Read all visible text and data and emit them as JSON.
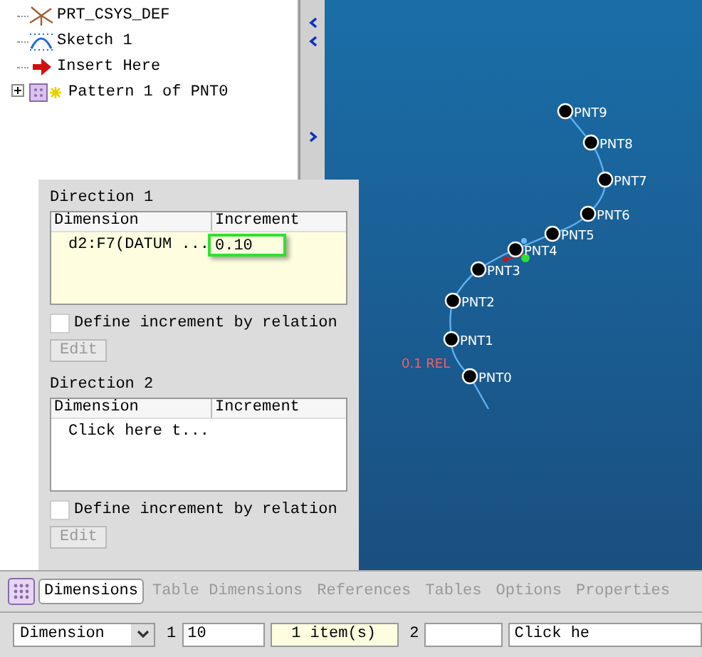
{
  "tree": {
    "items": [
      {
        "label": "PRT_CSYS_DEF",
        "kind": "csys"
      },
      {
        "label": "Sketch 1",
        "kind": "sketch"
      },
      {
        "label": "Insert Here",
        "kind": "insert"
      },
      {
        "label": "Pattern 1 of PNT0",
        "kind": "pattern",
        "expanded": false
      }
    ]
  },
  "viewport": {
    "points": [
      "PNT0",
      "PNT1",
      "PNT2",
      "PNT3",
      "PNT4",
      "PNT5",
      "PNT6",
      "PNT7",
      "PNT8",
      "PNT9"
    ],
    "annotation": "0.1 REL"
  },
  "panel": {
    "sections": [
      {
        "title": "Direction 1",
        "columns": [
          "Dimension",
          "Increment"
        ],
        "active": true,
        "rows": [
          {
            "dimension": "d2:F7(DATUM ...",
            "increment": "0.10",
            "editing": true
          }
        ],
        "relation": {
          "label": "Define increment by relation",
          "checked": false
        },
        "edit_button": {
          "label": "Edit",
          "disabled": true
        }
      },
      {
        "title": "Direction 2",
        "columns": [
          "Dimension",
          "Increment"
        ],
        "active": false,
        "rows": [
          {
            "dimension": "Click here t..."
          }
        ],
        "relation": {
          "label": "Define increment by relation",
          "checked": false
        },
        "edit_button": {
          "label": "Edit",
          "disabled": true
        }
      }
    ]
  },
  "tabs": [
    {
      "label": "Dimensions",
      "selected": true
    },
    {
      "label": "Table Dimensions",
      "selected": false
    },
    {
      "label": "References",
      "selected": false
    },
    {
      "label": "Tables",
      "selected": false
    },
    {
      "label": "Options",
      "selected": false
    },
    {
      "label": "Properties",
      "selected": false
    }
  ],
  "bottom_bar": {
    "type_select": "Dimension",
    "count_1": "1",
    "value_1": "10",
    "items_1": "1 item(s)",
    "count_2": "2",
    "hint": "Click he"
  }
}
